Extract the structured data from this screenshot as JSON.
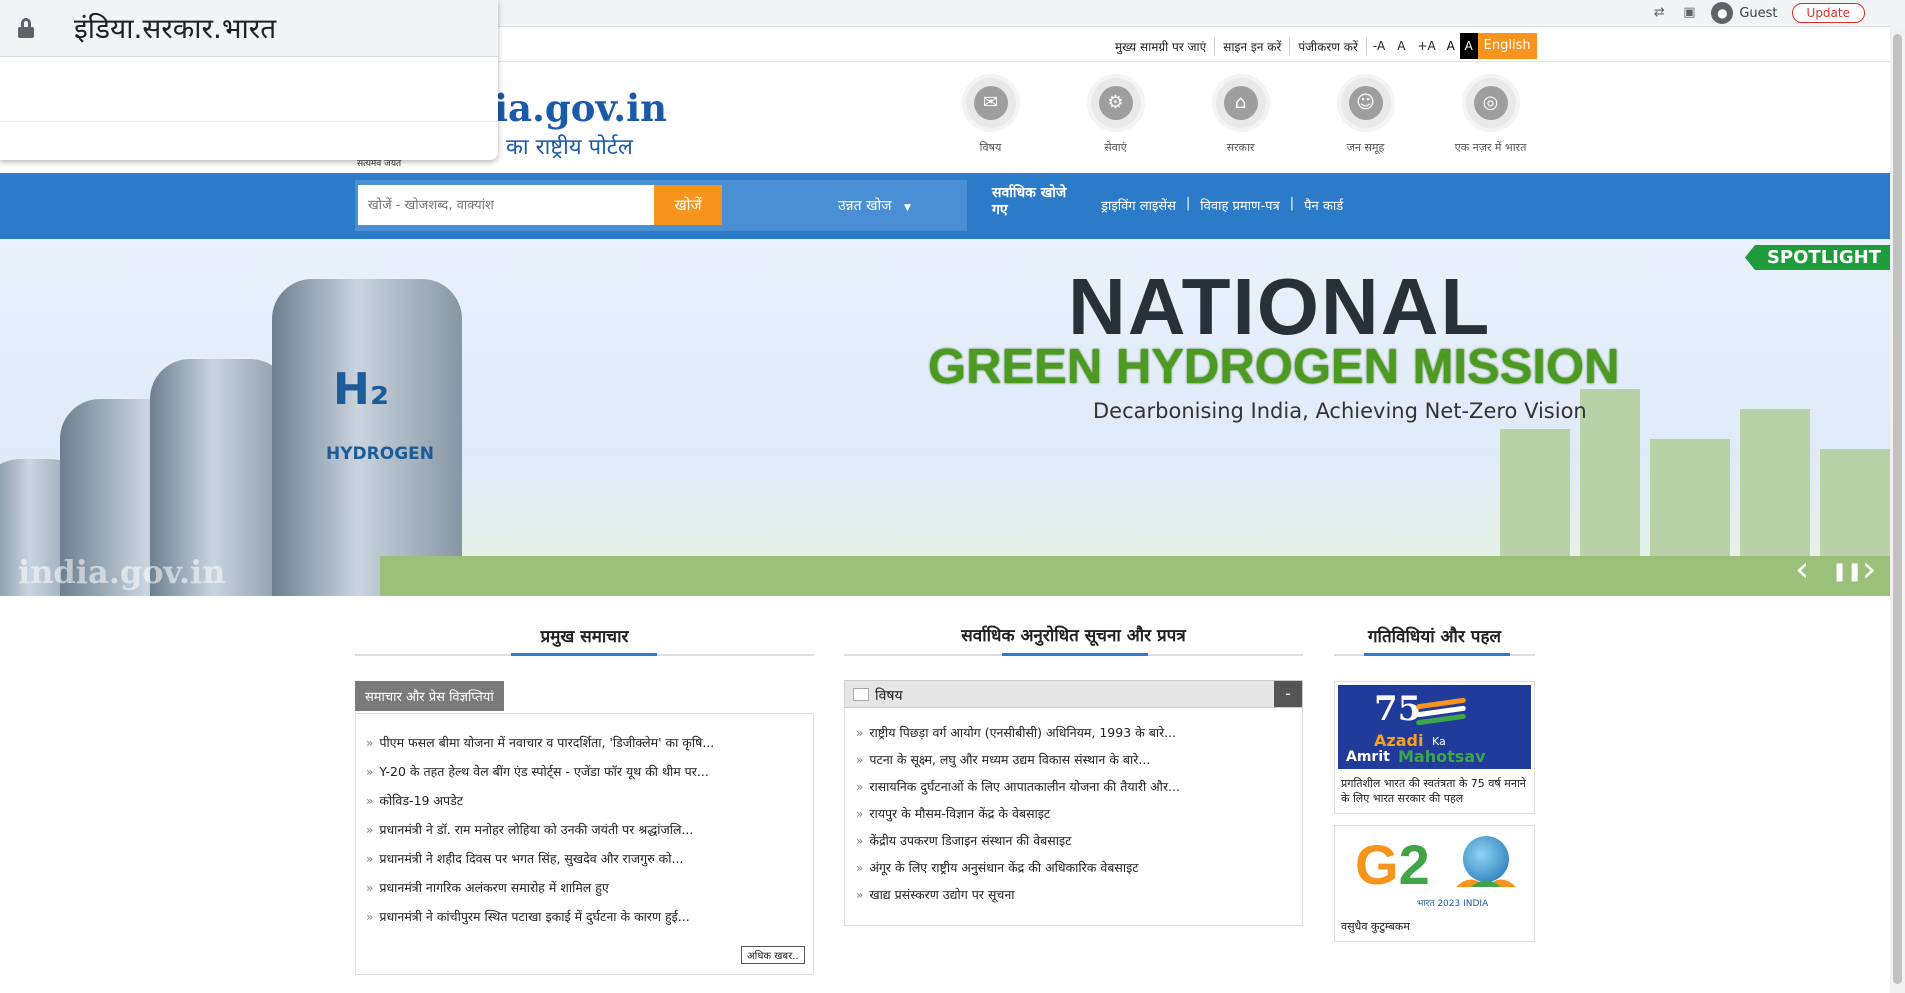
{
  "browser": {
    "url": "इंडिया.सरकार.भारत",
    "profile_label": "Guest",
    "update_label": "Update"
  },
  "utility": {
    "skip_main": "मुख्य सामग्री पर जाएं",
    "sign_in": "साइन इन करें",
    "register": "पंजीकरण करें",
    "font_minus": "-A",
    "font_normal": "A",
    "font_plus": "+A",
    "contrast_normal": "A",
    "contrast_high": "A",
    "language": "English"
  },
  "logo": {
    "main": "ia.gov.in",
    "sub": "का राष्ट्रीय पोर्टल",
    "emblem_tag": "सत्यमेव जयते"
  },
  "categories": [
    {
      "label": "विषय",
      "icon": "chat-icon"
    },
    {
      "label": "सेवाएं",
      "icon": "gear-icon"
    },
    {
      "label": "सरकार",
      "icon": "building-icon"
    },
    {
      "label": "जन समूह",
      "icon": "people-icon"
    },
    {
      "label": "एक नज़र में भारत",
      "icon": "target-icon"
    }
  ],
  "search": {
    "placeholder": "खोजें - खोजशब्द, वाक्यांश",
    "button": "खोजें",
    "advanced": "उन्नत खोज",
    "most_searched": "सर्वाधिक खोजे गए",
    "quick_links": [
      "ड्राइविंग लाइसेंस",
      "विवाह प्रमाण-पत्र",
      "पैन कार्ड"
    ]
  },
  "banner": {
    "spotlight": "SPOTLIGHT",
    "title": "NATIONAL",
    "subtitle": "GREEN HYDROGEN MISSION",
    "tagline": "Decarbonising India, Achieving Net-Zero Vision",
    "tank_h2": "H₂",
    "tank_word": "HYDROGEN",
    "watermark": "india.gov.in"
  },
  "news": {
    "heading": "प्रमुख समाचार",
    "tab": "समाचार और प्रेस विज्ञप्तियां",
    "items": [
      "पीएम फसल बीमा योजना में नवाचार व पारदर्शिता, 'डिजीक्लेम' का कृषि...",
      "Y-20 के तहत हेल्थ वेल बींग एंड स्पोर्ट्स - एजेंडा फॉर यूथ की थीम पर...",
      "कोविड-19 अपडेट",
      "प्रधानमंत्री ने डॉ. राम मनोहर लोहिया को उनकी जयंती पर श्रद्धांजलि...",
      "प्रधानमंत्री ने शहीद दिवस पर भगत सिंह, सुखदेव और राजगुरु को...",
      "प्रधानमंत्री नागरिक अलंकरण समारोह में शामिल हुए",
      "प्रधानमंत्री ने कांचीपुरम स्थित पटाखा इकाई में दुर्घटना के कारण हुई..."
    ],
    "more": "अधिक खबर.."
  },
  "requested": {
    "heading": "सर्वाधिक अनुरोधित सूचना और प्रपत्र",
    "topic": "विषय",
    "collapse": "-",
    "items": [
      "राष्ट्रीय पिछड़ा वर्ग आयोग (एनसीबीसी) अधिनियम, 1993 के बारे...",
      "पटना के सूक्ष्म, लघु और मध्यम उद्यम विकास संस्थान के बारे...",
      "रासायनिक दुर्घटनाओं के लिए आपातकालीन योजना की तैयारी और...",
      "रायपुर के मौसम-विज्ञान केंद्र के वेबसाइट",
      "केंद्रीय उपकरण डिजाइन संस्थान की वेबसाइट",
      "अंगूर के लिए राष्ट्रीय अनुसंधान केंद्र की अधिकारिक वेबसाइट",
      "खाद्य प्रसंस्करण उद्योग पर सूचना"
    ]
  },
  "activities": {
    "heading": "गतिविधियां और पहल",
    "card1": {
      "number": "75",
      "w_azadi": "Azadi",
      "w_ka": "Ka",
      "w_amrit": "Amrit",
      "w_mahotsav": "Mahotsav",
      "caption": "प्रगतिशील भारत की स्वतंत्रता के 75 वर्ष मनाने के लिए भारत सरकार की पहल"
    },
    "card2": {
      "g": "G",
      "two": "2",
      "sub": "भारत 2023 INDIA",
      "caption": "वसुधैव कुटुम्बकम"
    }
  }
}
